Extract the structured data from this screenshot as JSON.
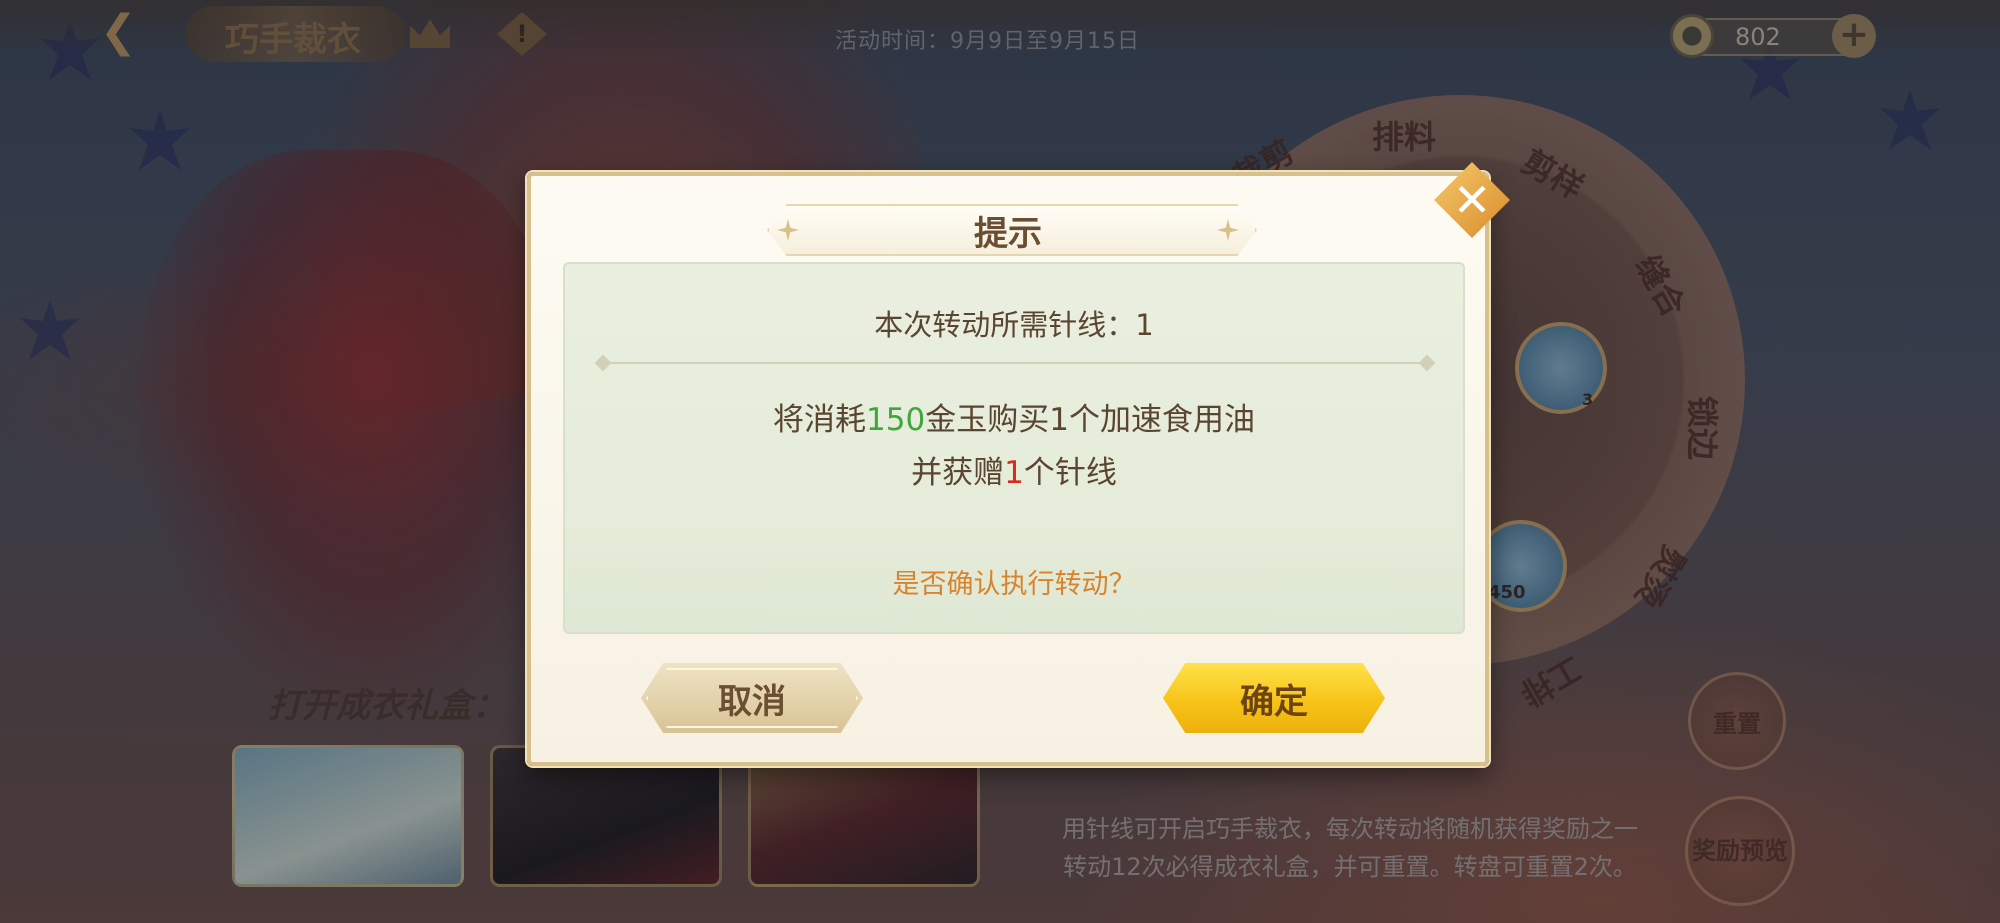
{
  "header": {
    "title": "巧手裁衣",
    "event_time": "活动时间：9月9日至9月15日",
    "currency_value": "802"
  },
  "wheel": {
    "segments": [
      "排料",
      "剪样",
      "缝合",
      "锁边",
      "熨烫",
      "工排",
      "裁剪"
    ],
    "badge_counts": [
      "3",
      "450"
    ]
  },
  "bottom": {
    "gift_label": "打开成衣礼盒：",
    "rules_line1": "用针线可开启巧手裁衣，每次转动将随机获得奖励之一",
    "rules_line2": "转动12次必得成衣礼盒，并可重置。转盘可重置2次。",
    "reset_label": "重置",
    "reward_preview_label": "奖励预览"
  },
  "dialog": {
    "title": "提示",
    "cost_line": "本次转动所需针线：1",
    "purchase_prefix": "将消耗",
    "purchase_amount": "150",
    "purchase_suffix": "金玉购买1个加速食用油",
    "gift_prefix": "并获赠",
    "gift_amount": "1",
    "gift_suffix": "个针线",
    "confirm_question": "是否确认执行转动？",
    "cancel_label": "取消",
    "ok_label": "确定"
  },
  "colors": {
    "highlight_green": "#3fa73a",
    "highlight_red": "#d82c22",
    "question_orange": "#d9842c",
    "ok_yellow": "#f7c418"
  },
  "icons": [
    "back-icon",
    "crown-icon",
    "info-icon",
    "jade-currency-icon",
    "add-icon",
    "close-icon"
  ]
}
